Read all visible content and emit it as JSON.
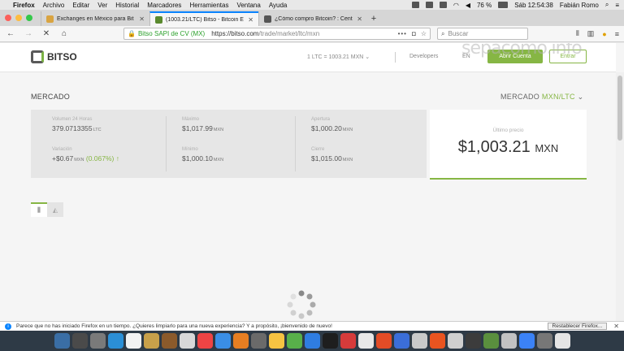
{
  "menubar": {
    "app": "Firefox",
    "items": [
      "Archivo",
      "Editar",
      "Ver",
      "Historial",
      "Marcadores",
      "Herramientas",
      "Ventana",
      "Ayuda"
    ],
    "battery": "76 %",
    "clock": "Sáb 12:54:38",
    "user": "Fabián Romo"
  },
  "tabs": [
    {
      "title": "Exchanges en México para Bit",
      "favicon_color": "#d9a441"
    },
    {
      "title": "(1003.21/LTC) Bitso - Bitcoin E",
      "favicon_color": "#5a8a2e"
    },
    {
      "title": "¿Cómo compro Bitcoin? : Cent",
      "favicon_color": "#555555"
    }
  ],
  "navbar": {
    "org": "Bitso SAPI de CV (MX)",
    "url_host": "https://bitso.com",
    "url_path": "/trade/market/ltc/mxn",
    "search_placeholder": "Buscar"
  },
  "site": {
    "logo_text": "BITSO",
    "rate": "1 LTC = 1003.21 MXN",
    "developers": "Developers",
    "lang": "EN",
    "open_account": "Abrir Cuenta",
    "login": "Entrar",
    "watermark": "sepacomo.info"
  },
  "market": {
    "title": "MERCADO",
    "selector_label": "MERCADO",
    "selector_pair": "MXN/LTC",
    "volume_label": "Volumen 24 Horas",
    "volume_value": "379.0713355",
    "volume_unit": "LTC",
    "variation_label": "Variación",
    "variation_value": "+$0.67",
    "variation_unit": "MXN",
    "variation_pct": "(0.067%) ↑",
    "max_label": "Máximo",
    "max_value": "$1,017.99",
    "max_unit": "MXN",
    "min_label": "Mínimo",
    "min_value": "$1,000.10",
    "min_unit": "MXN",
    "open_label": "Apertura",
    "open_value": "$1,000.20",
    "open_unit": "MXN",
    "close_label": "Cierre",
    "close_value": "$1,015.00",
    "close_unit": "MXN",
    "last_label": "Último precio",
    "last_value": "$1,003.21",
    "last_cur": "MXN"
  },
  "notification": {
    "text": "Parece que no has iniciado Firefox en un tiempo. ¿Quieres limpiarlo para una nueva experiencia? Y a propósito, ¡bienvenido de nuevo!",
    "button": "Restablecer Firefox..."
  },
  "dock_colors": [
    "#3a6ea5",
    "#4a4a4a",
    "#7a7a7a",
    "#2b8fd6",
    "#f2f2f2",
    "#c8a04a",
    "#8b5a2b",
    "#d8d8d8",
    "#e44",
    "#3a8ee6",
    "#e67e22",
    "#6a6a6a",
    "#f6c342",
    "#58b04a",
    "#2f7de1",
    "#1e1e1e",
    "#d63b3b",
    "#e8e8e8",
    "#e34c26",
    "#3b6ed8",
    "#c9c9c9",
    "#e95420",
    "#cfcfcf",
    "#3c3c3c",
    "#5a8f3e",
    "#c2c2c2",
    "#3b82f6",
    "#777",
    "#e5e5e5"
  ]
}
